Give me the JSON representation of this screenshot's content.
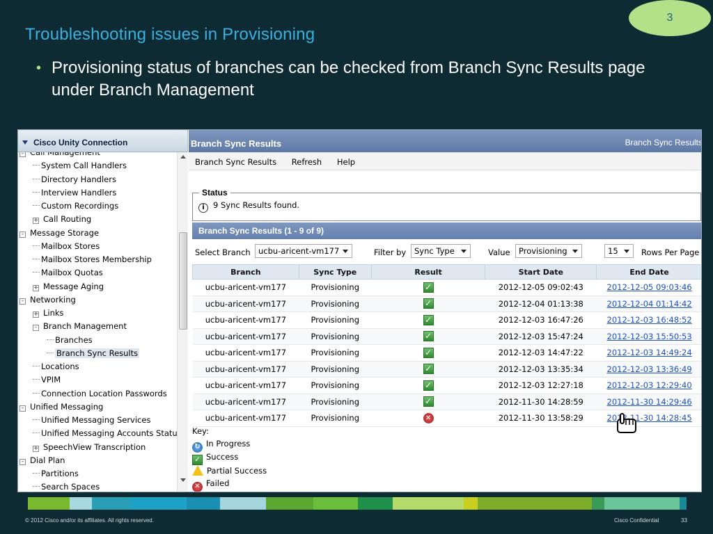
{
  "slide": {
    "number": "3",
    "title": "Troubleshooting issues in Provisioning",
    "bullet": "Provisioning  status of branches can be checked from Branch Sync Results page under Branch Management",
    "footer_left": "© 2012 Cisco and/or its affiliates. All rights reserved.",
    "footer_right": "Cisco Confidential",
    "footer_page": "33"
  },
  "tree": {
    "header": "Cisco Unity Connection",
    "items": [
      {
        "label": "Call Management",
        "level": 0,
        "toggle": "-"
      },
      {
        "label": "System Call Handlers",
        "level": 1,
        "toggle": ""
      },
      {
        "label": "Directory Handlers",
        "level": 1,
        "toggle": ""
      },
      {
        "label": "Interview Handlers",
        "level": 1,
        "toggle": ""
      },
      {
        "label": "Custom Recordings",
        "level": 1,
        "toggle": ""
      },
      {
        "label": "Call Routing",
        "level": 1,
        "toggle": "+"
      },
      {
        "label": "Message Storage",
        "level": 0,
        "toggle": "-"
      },
      {
        "label": "Mailbox Stores",
        "level": 1,
        "toggle": ""
      },
      {
        "label": "Mailbox Stores Membership",
        "level": 1,
        "toggle": ""
      },
      {
        "label": "Mailbox Quotas",
        "level": 1,
        "toggle": ""
      },
      {
        "label": "Message Aging",
        "level": 1,
        "toggle": "+"
      },
      {
        "label": "Networking",
        "level": 0,
        "toggle": "-"
      },
      {
        "label": "Links",
        "level": 1,
        "toggle": "+"
      },
      {
        "label": "Branch Management",
        "level": 1,
        "toggle": "-"
      },
      {
        "label": "Branches",
        "level": 2,
        "toggle": ""
      },
      {
        "label": "Branch Sync Results",
        "level": 2,
        "toggle": "",
        "selected": true
      },
      {
        "label": "Locations",
        "level": 1,
        "toggle": ""
      },
      {
        "label": "VPIM",
        "level": 1,
        "toggle": ""
      },
      {
        "label": "Connection Location Passwords",
        "level": 1,
        "toggle": ""
      },
      {
        "label": "Unified Messaging",
        "level": 0,
        "toggle": "-"
      },
      {
        "label": "Unified Messaging Services",
        "level": 1,
        "toggle": ""
      },
      {
        "label": "Unified Messaging Accounts Status",
        "level": 1,
        "toggle": ""
      },
      {
        "label": "SpeechView Transcription",
        "level": 1,
        "toggle": "+"
      },
      {
        "label": "Dial Plan",
        "level": 0,
        "toggle": "-"
      },
      {
        "label": "Partitions",
        "level": 1,
        "toggle": ""
      },
      {
        "label": "Search Spaces",
        "level": 1,
        "toggle": ""
      }
    ]
  },
  "main": {
    "header": "Branch Sync Results",
    "crumb": "Branch Sync Results",
    "menu": [
      "Branch Sync Results",
      "Refresh",
      "Help"
    ],
    "status_legend": "Status",
    "status_text": "9 Sync Results found.",
    "results_header": "Branch Sync Results  (1 - 9 of 9)",
    "filters": {
      "select_branch_label": "Select Branch",
      "select_branch_value": "ucbu-aricent-vm177",
      "filter_by_label": "Filter by",
      "filter_by_value": "Sync Type",
      "value_label": "Value",
      "value_value": "Provisioning",
      "rows_value": "15",
      "rows_label": "Rows Per Page"
    },
    "columns": [
      "Branch",
      "Sync Type",
      "Result",
      "Start Date",
      "End Date"
    ],
    "rows": [
      {
        "branch": "ucbu-aricent-vm177",
        "type": "Provisioning",
        "result": "success",
        "start": "2012-12-05 09:02:43",
        "end": "2012-12-05 09:03:46"
      },
      {
        "branch": "ucbu-aricent-vm177",
        "type": "Provisioning",
        "result": "success",
        "start": "2012-12-04 01:13:38",
        "end": "2012-12-04 01:14:42"
      },
      {
        "branch": "ucbu-aricent-vm177",
        "type": "Provisioning",
        "result": "success",
        "start": "2012-12-03 16:47:26",
        "end": "2012-12-03 16:48:52"
      },
      {
        "branch": "ucbu-aricent-vm177",
        "type": "Provisioning",
        "result": "success",
        "start": "2012-12-03 15:47:24",
        "end": "2012-12-03 15:50:53"
      },
      {
        "branch": "ucbu-aricent-vm177",
        "type": "Provisioning",
        "result": "success",
        "start": "2012-12-03 14:47:22",
        "end": "2012-12-03 14:49:24"
      },
      {
        "branch": "ucbu-aricent-vm177",
        "type": "Provisioning",
        "result": "success",
        "start": "2012-12-03 13:35:34",
        "end": "2012-12-03 13:36:49"
      },
      {
        "branch": "ucbu-aricent-vm177",
        "type": "Provisioning",
        "result": "success",
        "start": "2012-12-03 12:27:18",
        "end": "2012-12-03 12:29:40"
      },
      {
        "branch": "ucbu-aricent-vm177",
        "type": "Provisioning",
        "result": "success",
        "start": "2012-11-30 14:28:59",
        "end": "2012-11-30 14:29:46"
      },
      {
        "branch": "ucbu-aricent-vm177",
        "type": "Provisioning",
        "result": "failed",
        "start": "2012-11-30 13:58:29",
        "end": "2012-11-30 14:28:45"
      }
    ],
    "key_title": "Key:",
    "key": [
      {
        "icon": "in-progress-icon",
        "label": "In Progress"
      },
      {
        "icon": "success-icon",
        "label": "Success"
      },
      {
        "icon": "partial-success-icon",
        "label": "Partial Success"
      },
      {
        "icon": "failed-icon",
        "label": "Failed"
      }
    ]
  },
  "colors": {
    "background": "#0e2b33",
    "title": "#3ab0e0",
    "accent_green": "#b5e08a",
    "panel_header": "#6f89b4",
    "link": "#1a4fd0"
  }
}
